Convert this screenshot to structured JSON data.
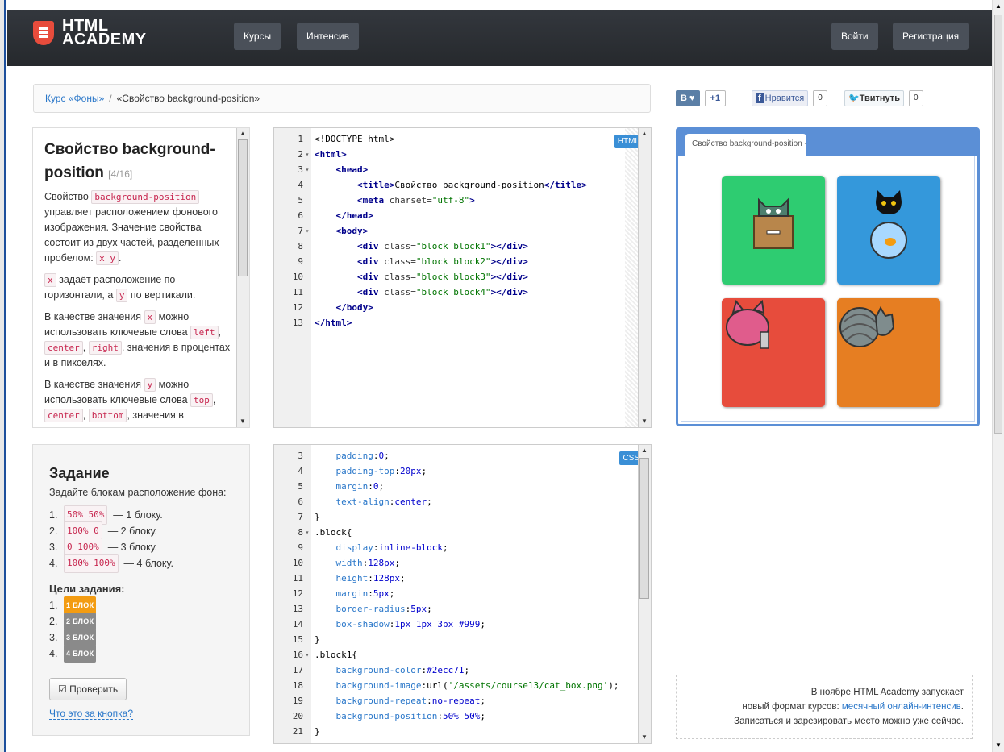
{
  "header": {
    "logo_line1": "HTML",
    "logo_line2": "ACADEMY",
    "nav": [
      "Курсы",
      "Интенсив"
    ],
    "login": "Войти",
    "register": "Регистрация"
  },
  "breadcrumb": {
    "course_link": "Курс «Фоны»",
    "separator": "/",
    "current": "«Свойство background-position»"
  },
  "share": {
    "vk": "В ♥",
    "gplus": "+1",
    "fb_label": "Нравится",
    "fb_count": "0",
    "tw_label": "Твитнуть",
    "tw_count": "0"
  },
  "theory": {
    "title": "Свойство background-position",
    "step": "[4/16]",
    "p1_a": "Свойство ",
    "p1_code": "background-position",
    "p1_b": " управляет расположением фонового изображения. Значение свойства состоит из двух частей, разделенных пробелом: ",
    "p1_code2": "x y",
    "p1_c": ".",
    "p2_code": "x",
    "p2_a": " задаёт расположение по горизонтали, а ",
    "p2_code2": "y",
    "p2_b": " по вертикали.",
    "p3_a": "В качестве значения ",
    "p3_code": "x",
    "p3_b": " можно использовать ключевые слова ",
    "p3_k1": "left",
    "p3_k2": "center",
    "p3_k3": "right",
    "p3_c": ", значения в процентах и в пикселях.",
    "p4_a": "В качестве значения ",
    "p4_code": "y",
    "p4_b": " можно использовать ключевые слова ",
    "p4_k1": "top",
    "p4_k2": "center",
    "p4_k3": "bottom",
    "p4_c": ", значения в"
  },
  "html_editor": {
    "badge": "HTML",
    "lines": [
      {
        "n": "1",
        "fold": "",
        "indent": 0,
        "parts": [
          [
            "plain",
            "<!DOCTYPE html>"
          ]
        ]
      },
      {
        "n": "2",
        "fold": "▾",
        "indent": 0,
        "parts": [
          [
            "tag",
            "<html>"
          ]
        ]
      },
      {
        "n": "3",
        "fold": "▾",
        "indent": 1,
        "parts": [
          [
            "tag",
            "<head>"
          ]
        ]
      },
      {
        "n": "4",
        "fold": "",
        "indent": 2,
        "parts": [
          [
            "tag",
            "<title>"
          ],
          [
            "plain",
            "Свойство background-position"
          ],
          [
            "tag",
            "</title>"
          ]
        ]
      },
      {
        "n": "5",
        "fold": "",
        "indent": 2,
        "parts": [
          [
            "tag",
            "<meta"
          ],
          [
            "attr",
            " charset="
          ],
          [
            "str",
            "\"utf-8\""
          ],
          [
            "tag",
            ">"
          ]
        ]
      },
      {
        "n": "6",
        "fold": "",
        "indent": 1,
        "parts": [
          [
            "tag",
            "</head>"
          ]
        ]
      },
      {
        "n": "7",
        "fold": "▾",
        "indent": 1,
        "parts": [
          [
            "tag",
            "<body>"
          ]
        ]
      },
      {
        "n": "8",
        "fold": "",
        "indent": 2,
        "parts": [
          [
            "tag",
            "<div"
          ],
          [
            "attr",
            " class="
          ],
          [
            "str",
            "\"block block1\""
          ],
          [
            "tag",
            "></div>"
          ]
        ]
      },
      {
        "n": "9",
        "fold": "",
        "indent": 2,
        "parts": [
          [
            "tag",
            "<div"
          ],
          [
            "attr",
            " class="
          ],
          [
            "str",
            "\"block block2\""
          ],
          [
            "tag",
            "></div>"
          ]
        ]
      },
      {
        "n": "10",
        "fold": "",
        "indent": 2,
        "parts": [
          [
            "tag",
            "<div"
          ],
          [
            "attr",
            " class="
          ],
          [
            "str",
            "\"block block3\""
          ],
          [
            "tag",
            "></div>"
          ]
        ]
      },
      {
        "n": "11",
        "fold": "",
        "indent": 2,
        "parts": [
          [
            "tag",
            "<div"
          ],
          [
            "attr",
            " class="
          ],
          [
            "str",
            "\"block block4\""
          ],
          [
            "tag",
            "></div>"
          ]
        ]
      },
      {
        "n": "12",
        "fold": "",
        "indent": 1,
        "parts": [
          [
            "tag",
            "</body>"
          ]
        ]
      },
      {
        "n": "13",
        "fold": "",
        "indent": 0,
        "parts": [
          [
            "tag",
            "</html>"
          ]
        ]
      }
    ]
  },
  "css_editor": {
    "badge": "CSS",
    "lines": [
      {
        "n": "3",
        "fold": "",
        "indent": 1,
        "parts": [
          [
            "prop",
            "padding"
          ],
          [
            "plain",
            ":"
          ],
          [
            "val",
            "0"
          ],
          [
            "plain",
            ";"
          ]
        ]
      },
      {
        "n": "4",
        "fold": "",
        "indent": 1,
        "parts": [
          [
            "prop",
            "padding-top"
          ],
          [
            "plain",
            ":"
          ],
          [
            "val",
            "20px"
          ],
          [
            "plain",
            ";"
          ]
        ]
      },
      {
        "n": "5",
        "fold": "",
        "indent": 1,
        "parts": [
          [
            "prop",
            "margin"
          ],
          [
            "plain",
            ":"
          ],
          [
            "val",
            "0"
          ],
          [
            "plain",
            ";"
          ]
        ]
      },
      {
        "n": "6",
        "fold": "",
        "indent": 1,
        "parts": [
          [
            "prop",
            "text-align"
          ],
          [
            "plain",
            ":"
          ],
          [
            "val",
            "center"
          ],
          [
            "plain",
            ";"
          ]
        ]
      },
      {
        "n": "7",
        "fold": "",
        "indent": 0,
        "parts": [
          [
            "plain",
            "}"
          ]
        ]
      },
      {
        "n": "8",
        "fold": "▾",
        "indent": 0,
        "parts": [
          [
            "sel",
            ".block{"
          ]
        ]
      },
      {
        "n": "9",
        "fold": "",
        "indent": 1,
        "parts": [
          [
            "prop",
            "display"
          ],
          [
            "plain",
            ":"
          ],
          [
            "val",
            "inline-block"
          ],
          [
            "plain",
            ";"
          ]
        ]
      },
      {
        "n": "10",
        "fold": "",
        "indent": 1,
        "parts": [
          [
            "prop",
            "width"
          ],
          [
            "plain",
            ":"
          ],
          [
            "val",
            "128px"
          ],
          [
            "plain",
            ";"
          ]
        ]
      },
      {
        "n": "11",
        "fold": "",
        "indent": 1,
        "parts": [
          [
            "prop",
            "height"
          ],
          [
            "plain",
            ":"
          ],
          [
            "val",
            "128px"
          ],
          [
            "plain",
            ";"
          ]
        ]
      },
      {
        "n": "12",
        "fold": "",
        "indent": 1,
        "parts": [
          [
            "prop",
            "margin"
          ],
          [
            "plain",
            ":"
          ],
          [
            "val",
            "5px"
          ],
          [
            "plain",
            ";"
          ]
        ]
      },
      {
        "n": "13",
        "fold": "",
        "indent": 1,
        "parts": [
          [
            "prop",
            "border-radius"
          ],
          [
            "plain",
            ":"
          ],
          [
            "val",
            "5px"
          ],
          [
            "plain",
            ";"
          ]
        ]
      },
      {
        "n": "14",
        "fold": "",
        "indent": 1,
        "parts": [
          [
            "prop",
            "box-shadow"
          ],
          [
            "plain",
            ":"
          ],
          [
            "val",
            "1px 1px 3px #999"
          ],
          [
            "plain",
            ";"
          ]
        ]
      },
      {
        "n": "15",
        "fold": "",
        "indent": 0,
        "parts": [
          [
            "plain",
            "}"
          ]
        ]
      },
      {
        "n": "16",
        "fold": "▾",
        "indent": 0,
        "parts": [
          [
            "sel",
            ".block1{"
          ]
        ]
      },
      {
        "n": "17",
        "fold": "",
        "indent": 1,
        "parts": [
          [
            "prop",
            "background-color"
          ],
          [
            "plain",
            ":"
          ],
          [
            "val",
            "#2ecc71"
          ],
          [
            "plain",
            ";"
          ]
        ]
      },
      {
        "n": "18",
        "fold": "",
        "indent": 1,
        "parts": [
          [
            "prop",
            "background-image"
          ],
          [
            "plain",
            ":url("
          ],
          [
            "str",
            "'/assets/course13/cat_box.png'"
          ],
          [
            "plain",
            ");"
          ]
        ]
      },
      {
        "n": "19",
        "fold": "",
        "indent": 1,
        "parts": [
          [
            "prop",
            "background-repeat"
          ],
          [
            "plain",
            ":"
          ],
          [
            "val",
            "no-repeat"
          ],
          [
            "plain",
            ";"
          ]
        ]
      },
      {
        "n": "20",
        "fold": "",
        "indent": 1,
        "parts": [
          [
            "prop",
            "background-position"
          ],
          [
            "plain",
            ":"
          ],
          [
            "val",
            "50% 50%"
          ],
          [
            "plain",
            ";"
          ]
        ]
      },
      {
        "n": "21",
        "fold": "",
        "indent": 0,
        "parts": [
          [
            "plain",
            "}"
          ]
        ]
      }
    ]
  },
  "preview": {
    "tab_title": "Свойство background-position - HT",
    "blocks": [
      {
        "color": "#2ecc71",
        "icon": "cat-in-box-icon"
      },
      {
        "color": "#3498db",
        "icon": "cat-fishbowl-icon"
      },
      {
        "color": "#e74c3c",
        "icon": "cat-spray-icon"
      },
      {
        "color": "#e67e22",
        "icon": "cat-yarn-icon"
      }
    ]
  },
  "task": {
    "title": "Задание",
    "description": "Задайте блокам расположение фона:",
    "items": [
      {
        "n": "1.",
        "code": "50% 50%",
        "text": " — 1 блоку."
      },
      {
        "n": "2.",
        "code": "100% 0",
        "text": " — 2 блоку."
      },
      {
        "n": "3.",
        "code": "0 100%",
        "text": " — 3 блоку."
      },
      {
        "n": "4.",
        "code": "100% 100%",
        "text": " — 4 блоку."
      }
    ],
    "goals_title": "Цели задания:",
    "goals": [
      {
        "n": "1.",
        "label": "1 БЛОК",
        "state": "active"
      },
      {
        "n": "2.",
        "label": "2 БЛОК",
        "state": "off"
      },
      {
        "n": "3.",
        "label": "3 БЛОК",
        "state": "off"
      },
      {
        "n": "4.",
        "label": "4 БЛОК",
        "state": "off"
      }
    ],
    "check_button": "Проверить",
    "what_link": "Что это за кнопка?"
  },
  "promo": {
    "line1": "В ноябре HTML Academy запускает",
    "line2_a": "новый формат курсов: ",
    "line2_link": "месячный онлайн-интенсив",
    "line2_b": ".",
    "line3": "Записаться и зарезировать место можно уже сейчас."
  }
}
